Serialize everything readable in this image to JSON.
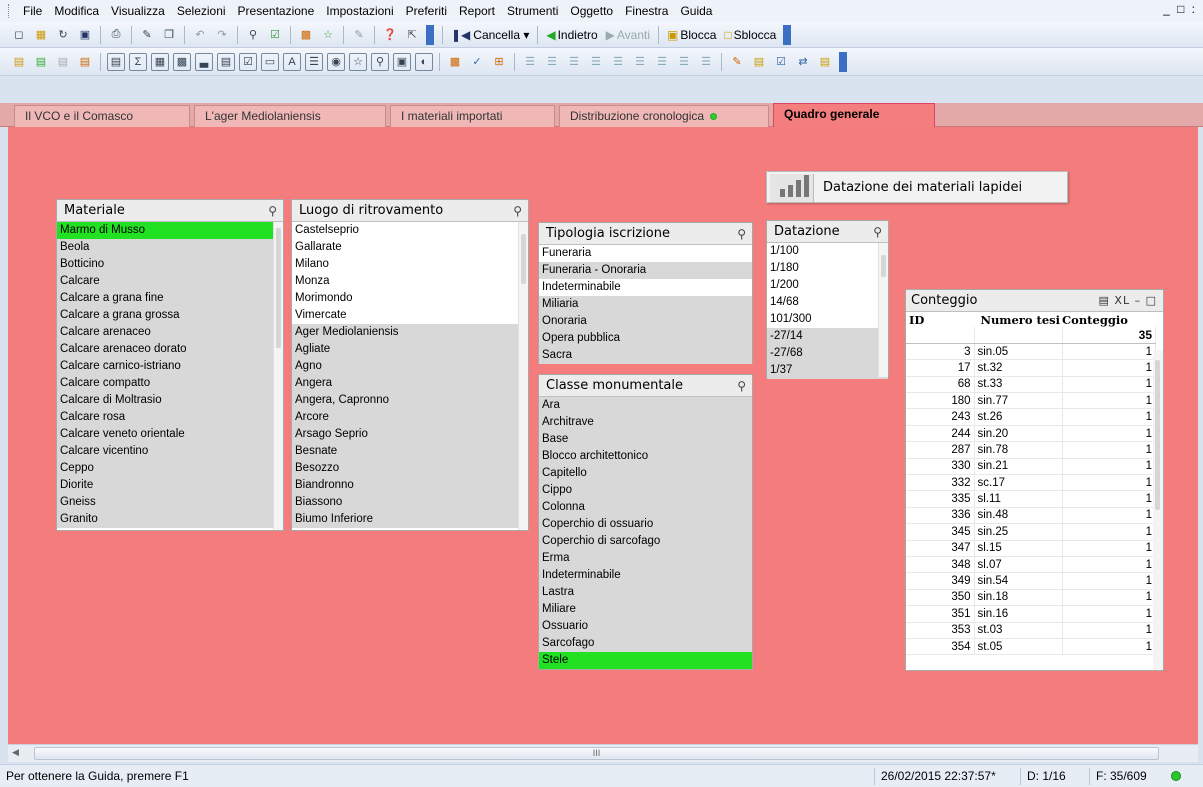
{
  "menu": [
    "File",
    "Modifica",
    "Visualizza",
    "Selezioni",
    "Presentazione",
    "Impostazioni",
    "Preferiti",
    "Report",
    "Strumenti",
    "Oggetto",
    "Finestra",
    "Guida"
  ],
  "window_controls": "_ % :",
  "toolbar": {
    "clear_label": "Cancella",
    "back_label": "Indietro",
    "forward_label": "Avanti",
    "lock_label": "Blocca",
    "unlock_label": "Sblocca"
  },
  "tabs": [
    {
      "label": "Il VCO e il Comasco"
    },
    {
      "label": "L'ager Mediolaniensis"
    },
    {
      "label": "I materiali importati"
    },
    {
      "label": "Distribuzione cronologica"
    },
    {
      "label": "Quadro generale"
    }
  ],
  "materiale": {
    "title": "Materiale",
    "items": [
      "Marmo di Musso",
      "Beola",
      "Botticino",
      "Calcare",
      "Calcare a grana fine",
      "Calcare a grana grossa",
      "Calcare arenaceo",
      "Calcare arenaceo dorato",
      "Calcare carnico-istriano",
      "Calcare compatto",
      "Calcare di Moltrasio",
      "Calcare rosa",
      "Calcare veneto orientale",
      "Calcare vicentino",
      "Ceppo",
      "Diorite",
      "Gneiss",
      "Granito"
    ]
  },
  "luogo": {
    "title": "Luogo di ritrovamento",
    "items": [
      "Castelseprio",
      "Gallarate",
      "Milano",
      "Monza",
      "Morimondo",
      "Vimercate",
      "Ager Mediolaniensis",
      "Agliate",
      "Agno",
      "Angera",
      "Angera, Capronno",
      "Arcore",
      "Arsago Seprio",
      "Besnate",
      "Besozzo",
      "Biandronno",
      "Biassono",
      "Biumo Inferiore"
    ]
  },
  "tipologia": {
    "title": "Tipologia iscrizione",
    "items": [
      "Funeraria",
      "Funeraria - Onoraria",
      "Indeterminabile",
      "Miliaria",
      "Onoraria",
      "Opera pubblica",
      "Sacra"
    ]
  },
  "classe": {
    "title": "Classe monumentale",
    "items": [
      "Ara",
      "Architrave",
      "Base",
      "Blocco architettonico",
      "Capitello",
      "Cippo",
      "Colonna",
      "Coperchio di ossuario",
      "Coperchio di sarcofago",
      "Erma",
      "Indeterminabile",
      "Lastra",
      "Miliare",
      "Ossuario",
      "Sarcofago",
      "Stele"
    ]
  },
  "datazione": {
    "title": "Datazione",
    "items": [
      "1/100",
      "1/180",
      "1/200",
      "14/68",
      "101/300",
      "-27/14",
      "-27/68",
      "1/37"
    ]
  },
  "text_object": {
    "label": "Datazione dei materiali lapidei"
  },
  "conteggio": {
    "title": "Conteggio",
    "controls": "▤ XL – □",
    "headers": [
      "ID",
      "Numero tesi",
      "Conteggio"
    ],
    "total": "35",
    "rows": [
      [
        "3",
        "sin.05",
        "1"
      ],
      [
        "17",
        "st.32",
        "1"
      ],
      [
        "68",
        "st.33",
        "1"
      ],
      [
        "180",
        "sin.77",
        "1"
      ],
      [
        "243",
        "st.26",
        "1"
      ],
      [
        "244",
        "sin.20",
        "1"
      ],
      [
        "287",
        "sin.78",
        "1"
      ],
      [
        "330",
        "sin.21",
        "1"
      ],
      [
        "332",
        "sc.17",
        "1"
      ],
      [
        "335",
        "sl.11",
        "1"
      ],
      [
        "336",
        "sin.48",
        "1"
      ],
      [
        "345",
        "sin.25",
        "1"
      ],
      [
        "347",
        "sl.15",
        "1"
      ],
      [
        "348",
        "sl.07",
        "1"
      ],
      [
        "349",
        "sin.54",
        "1"
      ],
      [
        "350",
        "sin.18",
        "1"
      ],
      [
        "351",
        "sin.16",
        "1"
      ],
      [
        "353",
        "st.03",
        "1"
      ],
      [
        "354",
        "st.05",
        "1"
      ]
    ]
  },
  "hscroll_grip": "III",
  "status": {
    "message": "Per ottenere la Guida, premere F1",
    "datetime": "26/02/2015 22:37:57*",
    "d": "D: 1/16",
    "f": "F: 35/609"
  }
}
